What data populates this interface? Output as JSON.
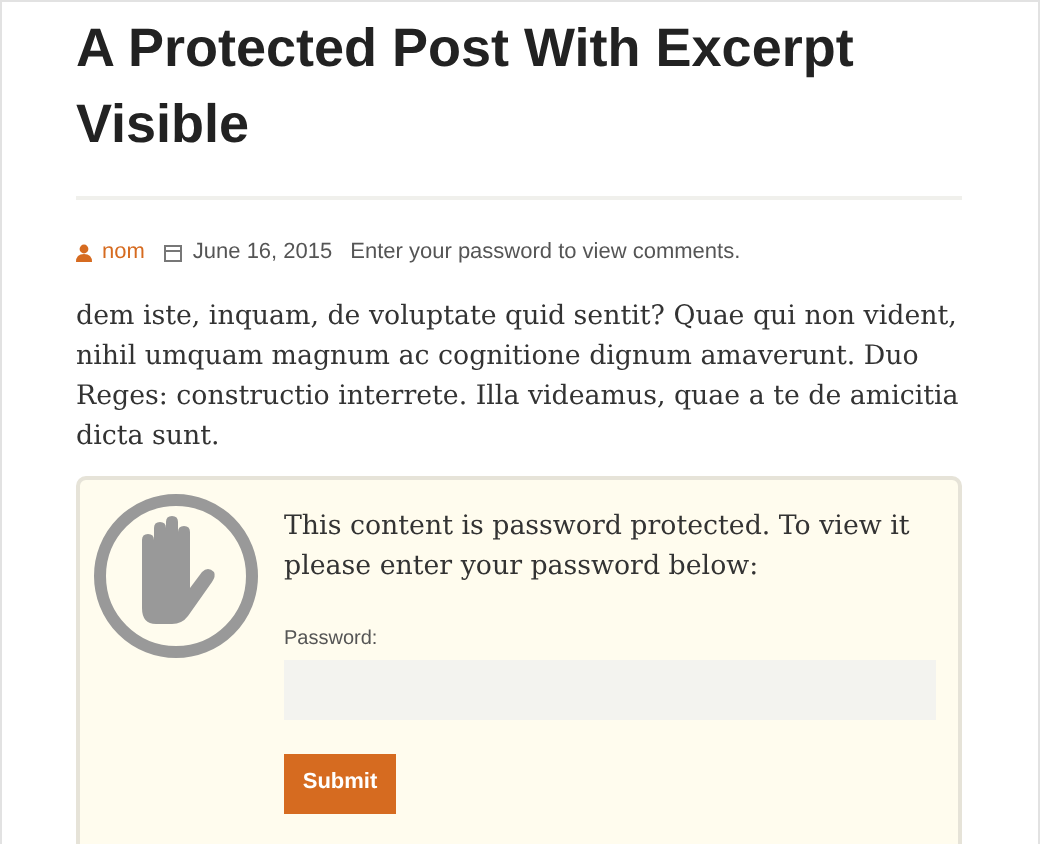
{
  "post": {
    "title": "A Protected Post With Excerpt Visible",
    "meta": {
      "author": "nom",
      "date": "June 16, 2015",
      "comments": "Enter your password to view comments."
    },
    "excerpt": "dem iste, inquam, de voluptate quid sentit? Quae qui non vident, nihil umquam magnum ac cognitione dignum amaverunt. Duo Reges: constructio interrete. Illa videamus, quae a te de amicitia dicta sunt."
  },
  "protected_box": {
    "message": "This content is password protected. To view it please enter your password below:",
    "field_label": "Password:",
    "button": "Submit"
  }
}
